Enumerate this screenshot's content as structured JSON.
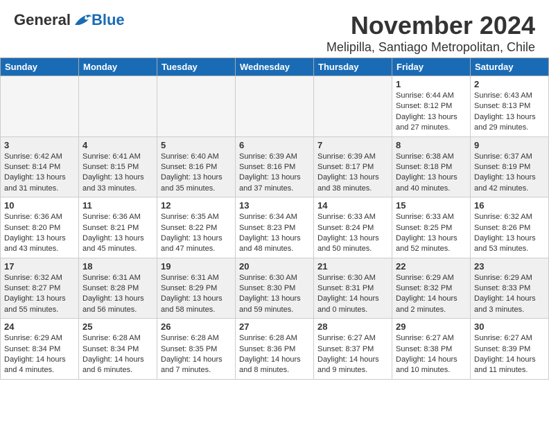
{
  "header": {
    "logo_general": "General",
    "logo_blue": "Blue",
    "title": "November 2024",
    "location": "Melipilla, Santiago Metropolitan, Chile"
  },
  "weekdays": [
    "Sunday",
    "Monday",
    "Tuesday",
    "Wednesday",
    "Thursday",
    "Friday",
    "Saturday"
  ],
  "weeks": [
    [
      {
        "day": "",
        "info": ""
      },
      {
        "day": "",
        "info": ""
      },
      {
        "day": "",
        "info": ""
      },
      {
        "day": "",
        "info": ""
      },
      {
        "day": "",
        "info": ""
      },
      {
        "day": "1",
        "info": "Sunrise: 6:44 AM\nSunset: 8:12 PM\nDaylight: 13 hours\nand 27 minutes."
      },
      {
        "day": "2",
        "info": "Sunrise: 6:43 AM\nSunset: 8:13 PM\nDaylight: 13 hours\nand 29 minutes."
      }
    ],
    [
      {
        "day": "3",
        "info": "Sunrise: 6:42 AM\nSunset: 8:14 PM\nDaylight: 13 hours\nand 31 minutes."
      },
      {
        "day": "4",
        "info": "Sunrise: 6:41 AM\nSunset: 8:15 PM\nDaylight: 13 hours\nand 33 minutes."
      },
      {
        "day": "5",
        "info": "Sunrise: 6:40 AM\nSunset: 8:16 PM\nDaylight: 13 hours\nand 35 minutes."
      },
      {
        "day": "6",
        "info": "Sunrise: 6:39 AM\nSunset: 8:16 PM\nDaylight: 13 hours\nand 37 minutes."
      },
      {
        "day": "7",
        "info": "Sunrise: 6:39 AM\nSunset: 8:17 PM\nDaylight: 13 hours\nand 38 minutes."
      },
      {
        "day": "8",
        "info": "Sunrise: 6:38 AM\nSunset: 8:18 PM\nDaylight: 13 hours\nand 40 minutes."
      },
      {
        "day": "9",
        "info": "Sunrise: 6:37 AM\nSunset: 8:19 PM\nDaylight: 13 hours\nand 42 minutes."
      }
    ],
    [
      {
        "day": "10",
        "info": "Sunrise: 6:36 AM\nSunset: 8:20 PM\nDaylight: 13 hours\nand 43 minutes."
      },
      {
        "day": "11",
        "info": "Sunrise: 6:36 AM\nSunset: 8:21 PM\nDaylight: 13 hours\nand 45 minutes."
      },
      {
        "day": "12",
        "info": "Sunrise: 6:35 AM\nSunset: 8:22 PM\nDaylight: 13 hours\nand 47 minutes."
      },
      {
        "day": "13",
        "info": "Sunrise: 6:34 AM\nSunset: 8:23 PM\nDaylight: 13 hours\nand 48 minutes."
      },
      {
        "day": "14",
        "info": "Sunrise: 6:33 AM\nSunset: 8:24 PM\nDaylight: 13 hours\nand 50 minutes."
      },
      {
        "day": "15",
        "info": "Sunrise: 6:33 AM\nSunset: 8:25 PM\nDaylight: 13 hours\nand 52 minutes."
      },
      {
        "day": "16",
        "info": "Sunrise: 6:32 AM\nSunset: 8:26 PM\nDaylight: 13 hours\nand 53 minutes."
      }
    ],
    [
      {
        "day": "17",
        "info": "Sunrise: 6:32 AM\nSunset: 8:27 PM\nDaylight: 13 hours\nand 55 minutes."
      },
      {
        "day": "18",
        "info": "Sunrise: 6:31 AM\nSunset: 8:28 PM\nDaylight: 13 hours\nand 56 minutes."
      },
      {
        "day": "19",
        "info": "Sunrise: 6:31 AM\nSunset: 8:29 PM\nDaylight: 13 hours\nand 58 minutes."
      },
      {
        "day": "20",
        "info": "Sunrise: 6:30 AM\nSunset: 8:30 PM\nDaylight: 13 hours\nand 59 minutes."
      },
      {
        "day": "21",
        "info": "Sunrise: 6:30 AM\nSunset: 8:31 PM\nDaylight: 14 hours\nand 0 minutes."
      },
      {
        "day": "22",
        "info": "Sunrise: 6:29 AM\nSunset: 8:32 PM\nDaylight: 14 hours\nand 2 minutes."
      },
      {
        "day": "23",
        "info": "Sunrise: 6:29 AM\nSunset: 8:33 PM\nDaylight: 14 hours\nand 3 minutes."
      }
    ],
    [
      {
        "day": "24",
        "info": "Sunrise: 6:29 AM\nSunset: 8:34 PM\nDaylight: 14 hours\nand 4 minutes."
      },
      {
        "day": "25",
        "info": "Sunrise: 6:28 AM\nSunset: 8:34 PM\nDaylight: 14 hours\nand 6 minutes."
      },
      {
        "day": "26",
        "info": "Sunrise: 6:28 AM\nSunset: 8:35 PM\nDaylight: 14 hours\nand 7 minutes."
      },
      {
        "day": "27",
        "info": "Sunrise: 6:28 AM\nSunset: 8:36 PM\nDaylight: 14 hours\nand 8 minutes."
      },
      {
        "day": "28",
        "info": "Sunrise: 6:27 AM\nSunset: 8:37 PM\nDaylight: 14 hours\nand 9 minutes."
      },
      {
        "day": "29",
        "info": "Sunrise: 6:27 AM\nSunset: 8:38 PM\nDaylight: 14 hours\nand 10 minutes."
      },
      {
        "day": "30",
        "info": "Sunrise: 6:27 AM\nSunset: 8:39 PM\nDaylight: 14 hours\nand 11 minutes."
      }
    ]
  ]
}
